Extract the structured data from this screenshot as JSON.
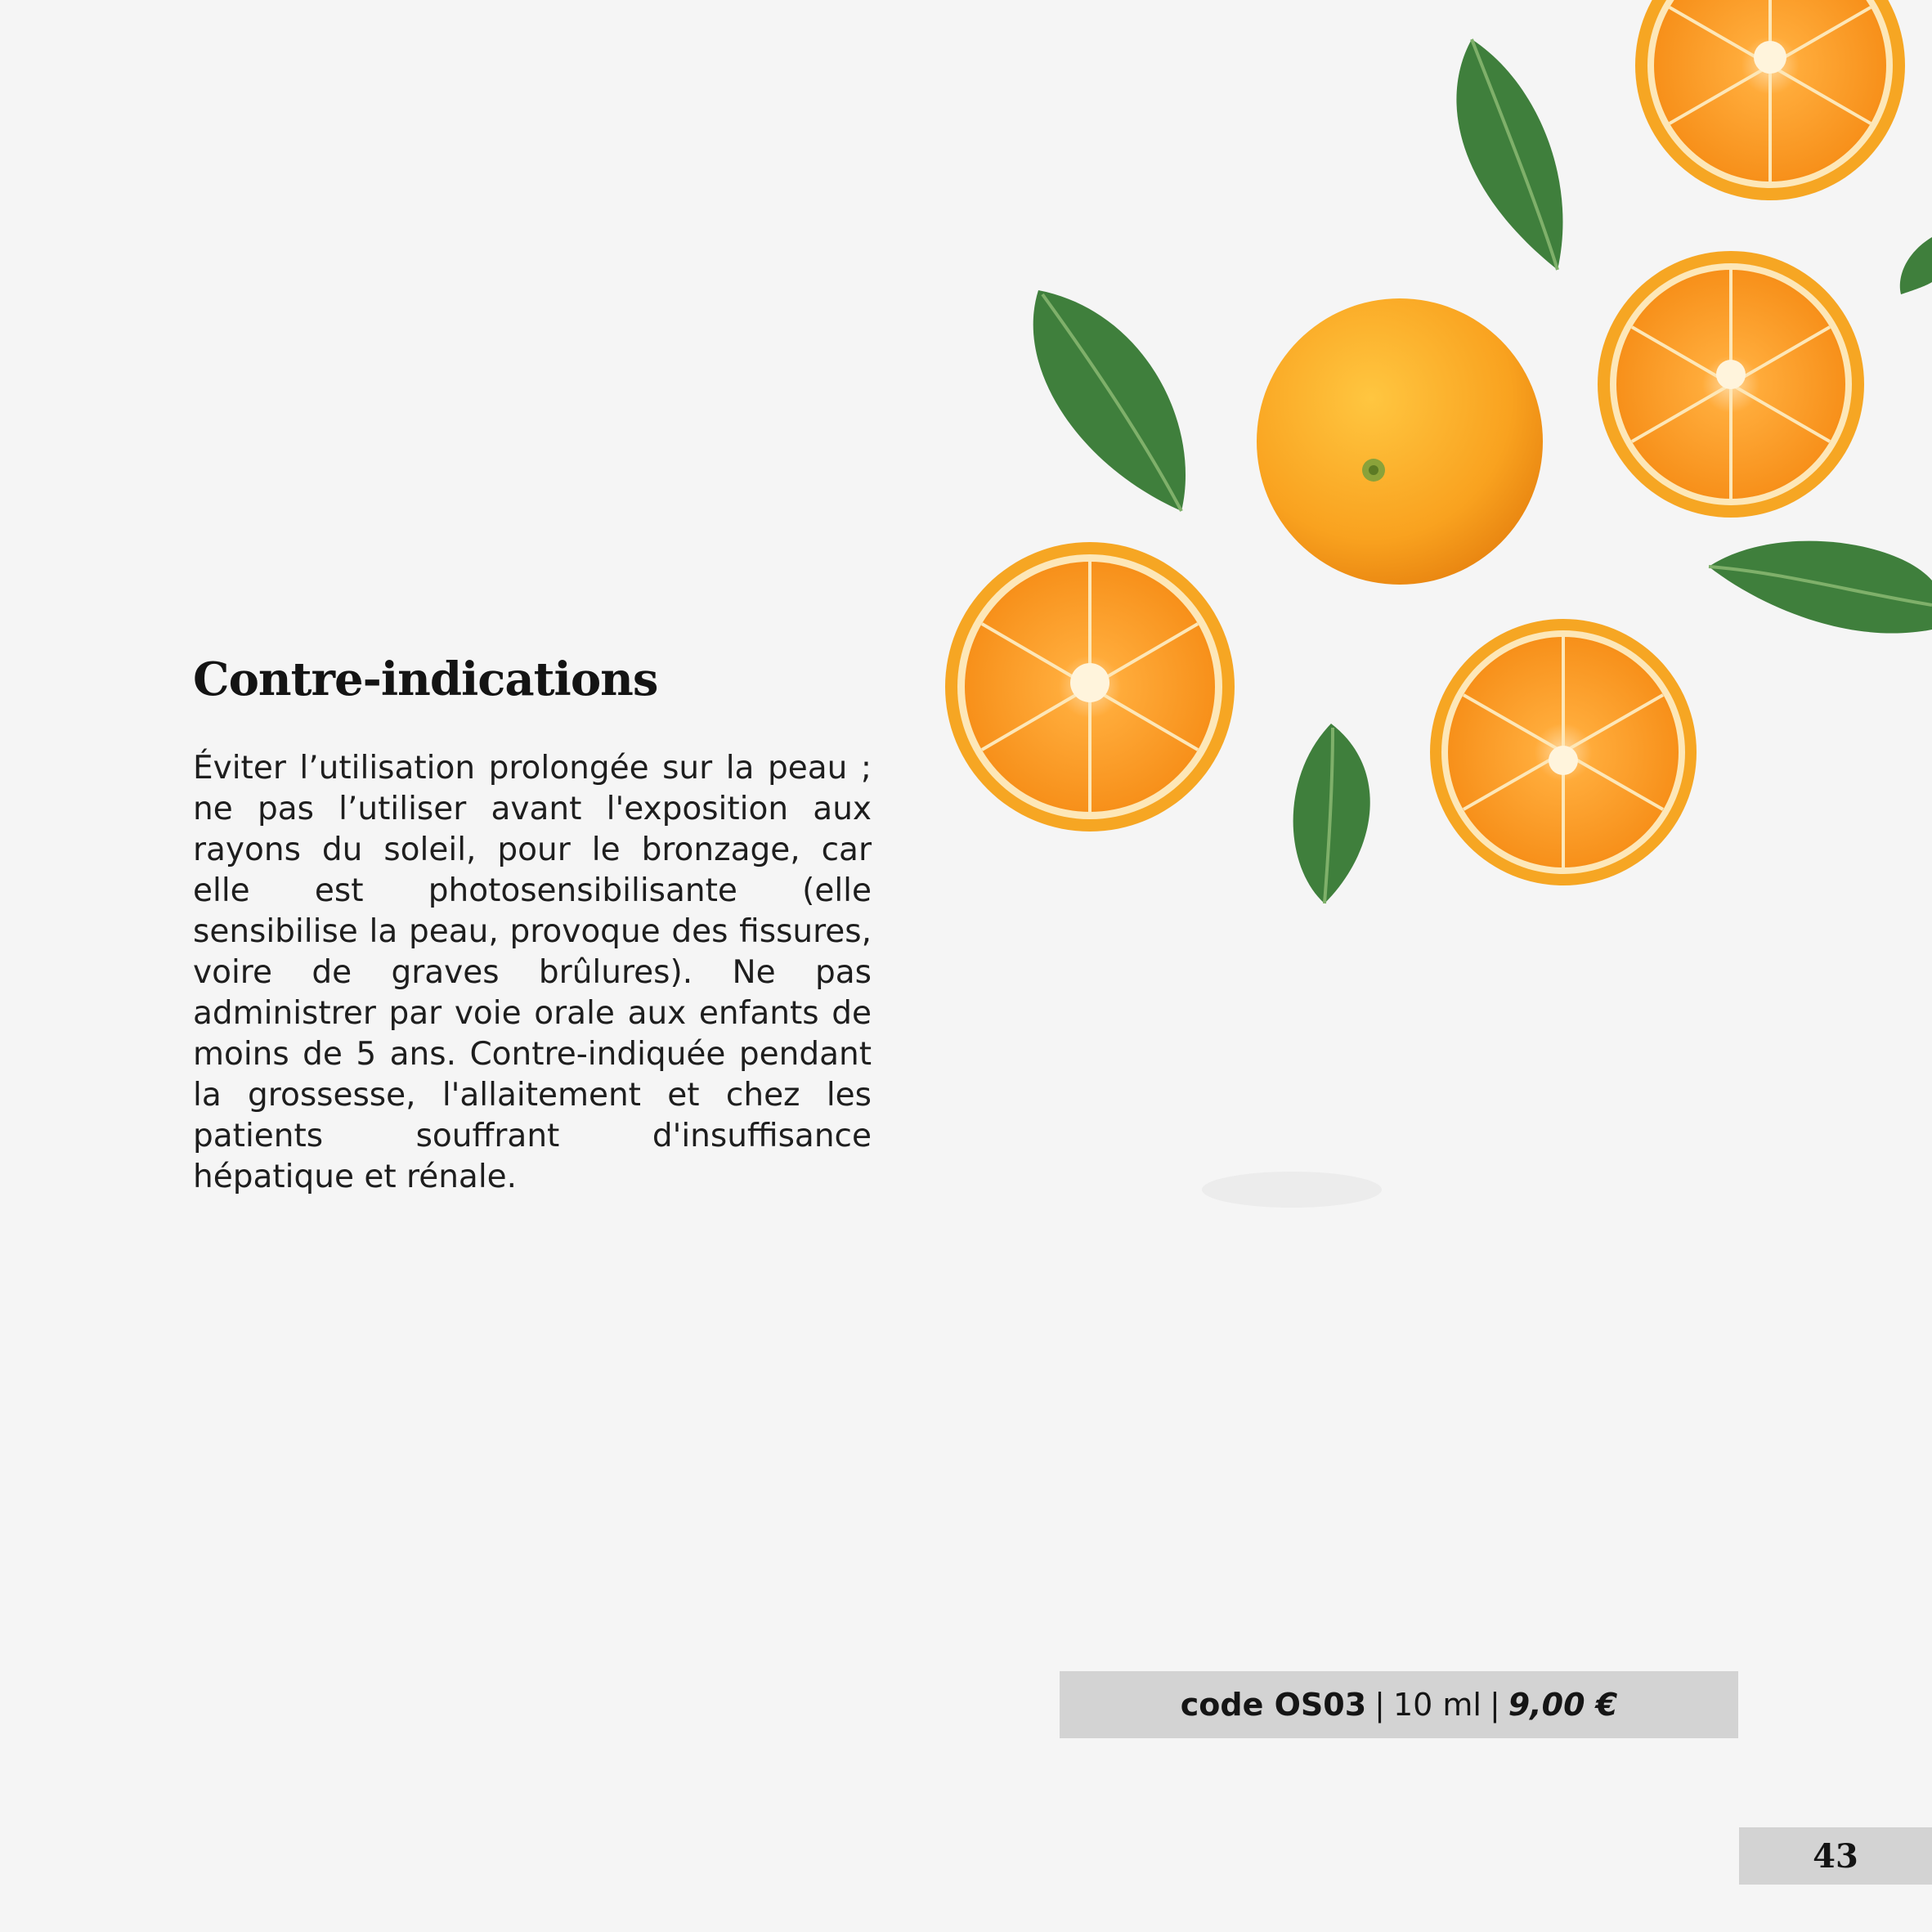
{
  "section": {
    "heading": "Contre-indications",
    "body": "Éviter l’utilisation prolongée sur la peau ; ne pas l’utiliser avant l'exposition aux rayons du soleil, pour le bronzage, car elle est photosensibilisante (elle sensibilise la peau, provoque des fissures, voire de graves brûlures). Ne pas administrer par voie orale aux enfants de moins de 5 ans. Contre-indiquée pendant la grossesse, l'allaitement et chez les patients souffrant d'insuffisance hépatique et rénale."
  },
  "product": {
    "code": "code OS03",
    "separator": "|",
    "volume": "10 ml",
    "price": "9,00 €"
  },
  "footer": {
    "page_number": "43"
  },
  "colors": {
    "background": "#f5f5f5",
    "bar": "#d3d3d3",
    "orange": "#f7931e",
    "orange_peel": "#f6a623",
    "leaf": "#3a7d3a"
  },
  "illustration": {
    "icon": "oranges-and-leaves-illustration"
  }
}
